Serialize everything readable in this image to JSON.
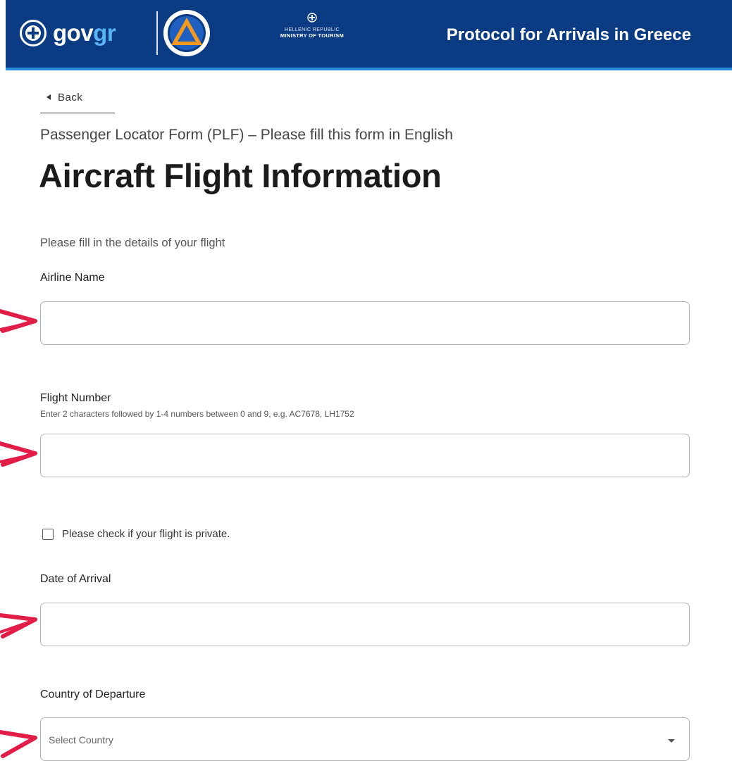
{
  "header": {
    "brand_prefix": "gov",
    "brand_suffix": "gr",
    "ministry_line1": "HELLENIC REPUBLIC",
    "ministry_line2": "MINISTRY OF TOURISM",
    "title": "Protocol for Arrivals in Greece",
    "colors": {
      "bar": "#0b3c83",
      "accent": "#2a8be0",
      "brand_suffix": "#5ab4f5"
    }
  },
  "nav": {
    "back_label": "Back"
  },
  "page": {
    "subtitle": "Passenger Locator Form (PLF) – Please fill this form in English",
    "title": "Aircraft Flight Information",
    "intro": "Please fill in the details of your flight"
  },
  "form": {
    "airline": {
      "label": "Airline Name",
      "value": ""
    },
    "flight_number": {
      "label": "Flight Number",
      "hint": "Enter 2 characters followed by 1-4 numbers between 0 and 9, e.g. AC7678, LH1752",
      "value": ""
    },
    "private_flight": {
      "label": "Please check if your flight is private.",
      "checked": false
    },
    "arrival_date": {
      "label": "Date of Arrival",
      "value": ""
    },
    "departure_country": {
      "label": "Country of Departure",
      "placeholder": "Select Country"
    }
  },
  "annotation": {
    "arrow_color": "#e11d48",
    "icon": "hand-drawn-arrow-icon"
  }
}
